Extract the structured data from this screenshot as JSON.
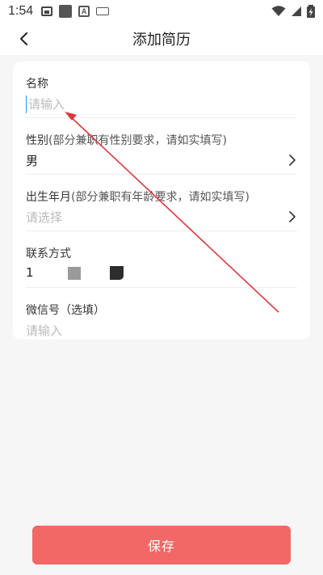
{
  "status_bar": {
    "time": "1:54"
  },
  "header": {
    "title": "添加简历",
    "back_icon": "chevron-left-icon"
  },
  "form": {
    "name": {
      "label": "名称",
      "placeholder": "请输入"
    },
    "gender": {
      "label": "性别",
      "hint": "(部分兼职有性别要求，请如实填写)",
      "value": "男"
    },
    "birth": {
      "label": "出生年月",
      "hint": "(部分兼职有年龄要求，请如实填写)",
      "placeholder": "请选择"
    },
    "contact": {
      "label": "联系方式",
      "value": "1"
    },
    "wechat": {
      "label": "微信号（选填）",
      "placeholder": "请输入"
    }
  },
  "footer": {
    "save_label": "保存"
  },
  "colors": {
    "accent": "#f26866",
    "annotation": "#d9383d",
    "caret": "#3a8ef0"
  }
}
